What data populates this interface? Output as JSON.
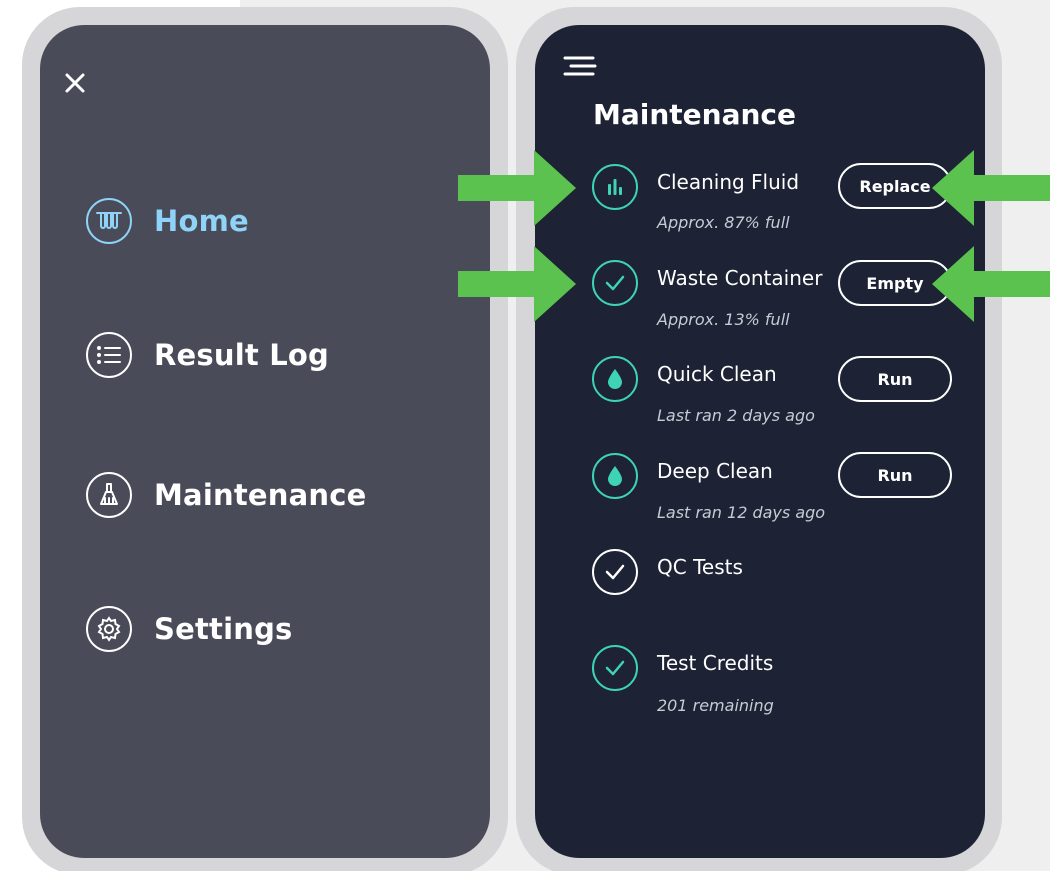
{
  "colors": {
    "accent_teal": "#3dd3b4",
    "active_blue": "#8fd3f8",
    "left_screen_bg": "#4a4b59",
    "right_screen_bg": "#1d2234",
    "arrow_green": "#5cc24f"
  },
  "menu": {
    "close_icon": "close-icon",
    "items": [
      {
        "label": "Home",
        "icon": "test-tubes-icon",
        "active": true
      },
      {
        "label": "Result Log",
        "icon": "list-icon",
        "active": false
      },
      {
        "label": "Maintenance",
        "icon": "broom-icon",
        "active": false
      },
      {
        "label": "Settings",
        "icon": "gear-icon",
        "active": false
      }
    ]
  },
  "maintenance": {
    "title": "Maintenance",
    "menu_icon": "hamburger-icon",
    "items": [
      {
        "title": "Cleaning Fluid",
        "subtitle": "Approx. 87% full",
        "icon": "bar-levels-icon",
        "action": "Replace"
      },
      {
        "title": "Waste Container",
        "subtitle": "Approx. 13% full",
        "icon": "check-icon",
        "action": "Empty"
      },
      {
        "title": "Quick Clean",
        "subtitle": "Last ran 2 days ago",
        "icon": "droplet-icon",
        "action": "Run"
      },
      {
        "title": "Deep Clean",
        "subtitle": "Last ran 12 days ago",
        "icon": "droplet-icon",
        "action": "Run"
      },
      {
        "title": "QC Tests",
        "subtitle": "",
        "icon": "check-icon",
        "action": ""
      },
      {
        "title": "Test Credits",
        "subtitle": "201 remaining",
        "icon": "check-icon",
        "action": ""
      }
    ]
  }
}
